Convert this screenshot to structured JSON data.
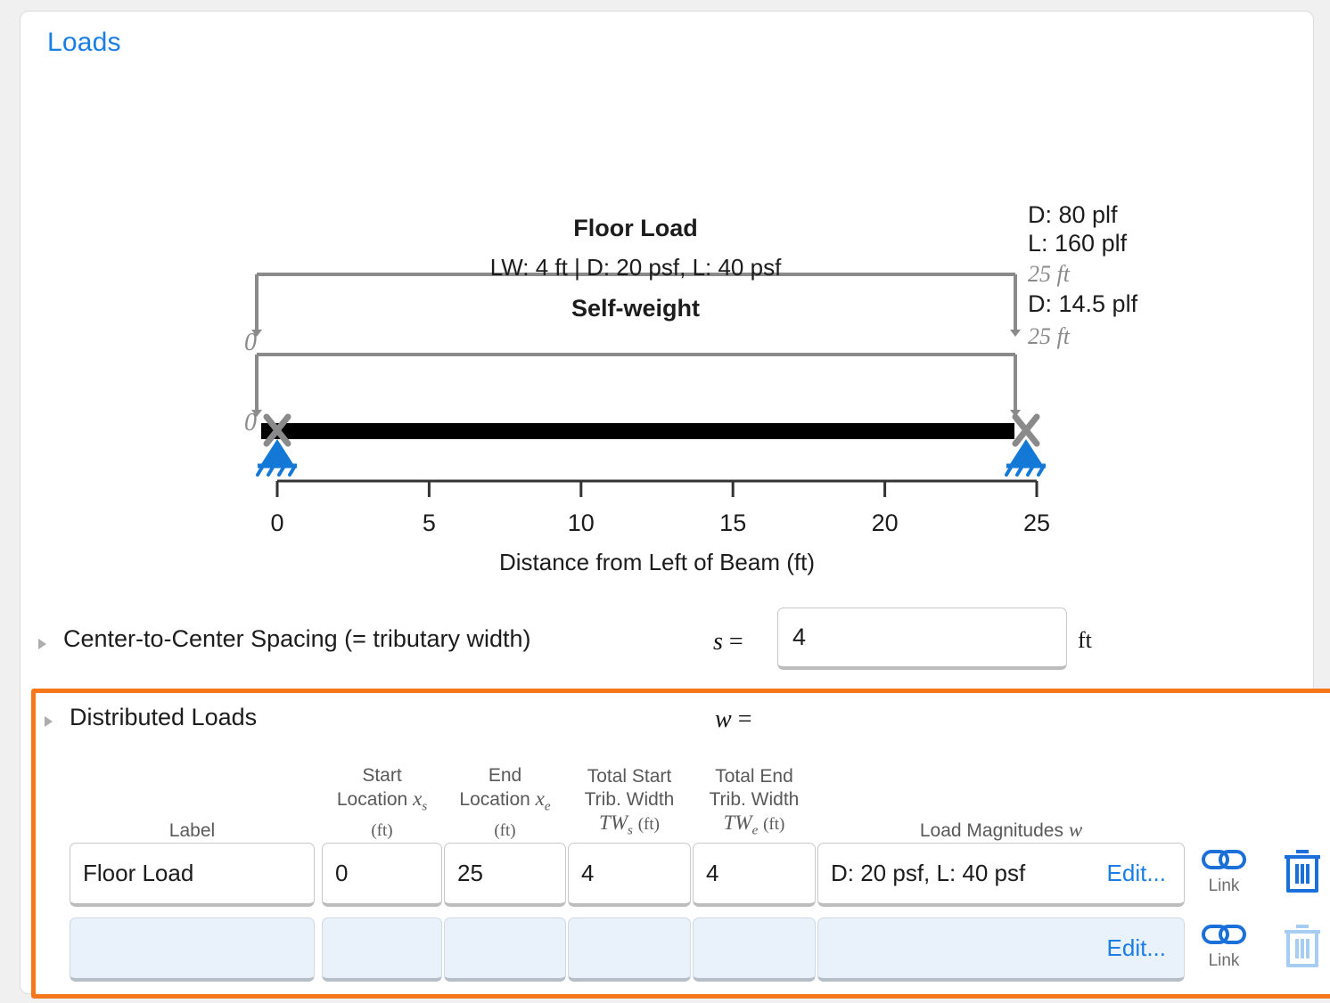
{
  "card": {
    "title": "Loads"
  },
  "diagram": {
    "axis": {
      "label": "Distance from Left of Beam (ft)",
      "ticks": [
        "0",
        "5",
        "10",
        "15",
        "20",
        "25"
      ],
      "tick_values": [
        0,
        5,
        10,
        15,
        20,
        25
      ],
      "min": 0,
      "max": 25
    },
    "loads": [
      {
        "name": "Floor Load",
        "detail": "LW: 4 ft | D: 20 psf, L: 40 psf",
        "start_label": "0",
        "end_label_1": "D: 80 plf",
        "end_label_2": "L: 160 plf",
        "end_station": "25 ft"
      },
      {
        "name": "Self-weight",
        "detail": "",
        "start_label": "0",
        "end_label_1": "D: 14.5 plf",
        "end_label_2": "",
        "end_station": "25 ft"
      }
    ],
    "supports": [
      "pinned-support-left",
      "pinned-support-right"
    ],
    "colors": {
      "support": "#1479d6",
      "beam": "#000000",
      "load_bracket": "#8a8a8a",
      "axis": "#333333"
    }
  },
  "spacing": {
    "disclosure": "chevron-right-icon",
    "label": "Center-to-Center Spacing (= tributary width)",
    "symbol": "s",
    "equals": "=",
    "value": "4",
    "unit": "ft"
  },
  "distributed_loads": {
    "disclosure": "chevron-right-icon",
    "title": "Distributed Loads",
    "symbol": "w",
    "equals": "=",
    "highlight_color": "#f5771a",
    "headers": {
      "label": "Label",
      "start_location_l1": "Start",
      "start_location_l2": "Location",
      "start_location_sym": "x",
      "start_location_sub": "s",
      "start_location_unit": "(ft)",
      "end_location_l1": "End",
      "end_location_l2": "Location",
      "end_location_sym": "x",
      "end_location_sub": "e",
      "end_location_unit": "(ft)",
      "total_start_l1": "Total Start",
      "total_start_l2": "Trib. Width",
      "total_start_sym": "TW",
      "total_start_sub": "s",
      "total_start_unit": "(ft)",
      "total_end_l1": "Total End",
      "total_end_l2": "Trib. Width",
      "total_end_sym": "TW",
      "total_end_sub": "e",
      "total_end_unit": "(ft)",
      "magnitudes": "Load Magnitudes",
      "magnitudes_sym": "w"
    },
    "rows": [
      {
        "label": "Floor Load",
        "start_location": "0",
        "end_location": "25",
        "total_start_trib_width": "4",
        "total_end_trib_width": "4",
        "magnitudes": "D: 20 psf, L: 40 psf",
        "edit_label": "Edit...",
        "link_label": "Link",
        "link_icon": "link-icon",
        "delete_icon": "trash-icon",
        "enabled": true
      },
      {
        "label": "",
        "start_location": "",
        "end_location": "",
        "total_start_trib_width": "",
        "total_end_trib_width": "",
        "magnitudes": "",
        "edit_label": "Edit...",
        "link_label": "Link",
        "link_icon": "link-icon",
        "delete_icon": "trash-icon",
        "enabled": false
      }
    ]
  }
}
